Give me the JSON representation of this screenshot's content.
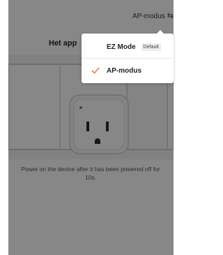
{
  "header": {
    "mode_label": "AP-modus",
    "swap_icon": "swap-arrows-icon"
  },
  "main": {
    "heading": "Het app",
    "caption": "Power on the device after it has been powered off for 10s."
  },
  "popup": {
    "options": [
      {
        "label": "EZ Mode",
        "badge": "Default",
        "selected": false
      },
      {
        "label": "AP-modus",
        "selected": true
      }
    ],
    "check_icon": "checkmark-icon",
    "accent_color": "#f07a3a"
  }
}
